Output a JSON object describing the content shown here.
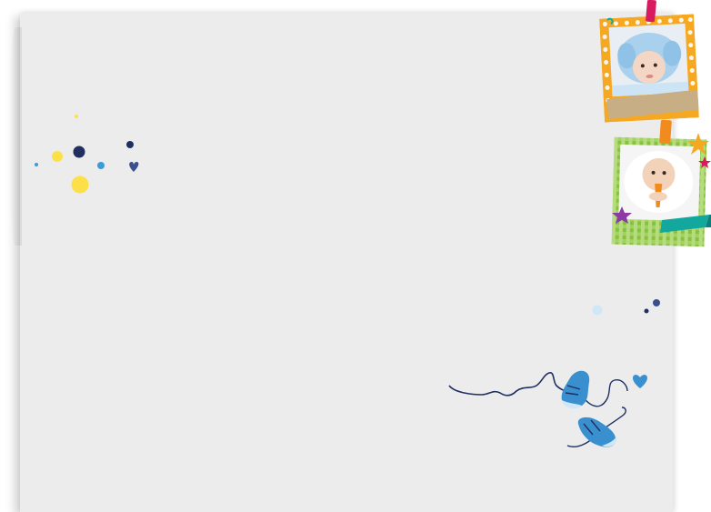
{
  "icons": {
    "dot_cluster": "confetti-dots",
    "heart": "heart-icon",
    "shoes": "baby-shoes-icon",
    "star": "star-icon",
    "clip": "clothespin-icon"
  },
  "colors": {
    "paper": "#ececec",
    "navy": "#1f2f5f",
    "sky": "#3d9bd6",
    "yellow": "#fde047",
    "light_blue": "#cfe7f7",
    "heart_blue": "#3a90cf",
    "heart_navy": "#3b4f8f",
    "frame_orange": "#f6a823",
    "frame_green": "#86c23f",
    "tape_tan": "#c7ae84",
    "clip_pink": "#d81b60",
    "clip_orange": "#f28b1d",
    "star_gold": "#f6a823",
    "star_purple": "#8e3aa6",
    "ribbon_teal": "#13a89e"
  },
  "photos": [
    {
      "name": "baby-elephant-hood-photo",
      "frame_style": "orange-dotted"
    },
    {
      "name": "baby-with-carrot-photo",
      "frame_style": "green-gingham"
    }
  ]
}
